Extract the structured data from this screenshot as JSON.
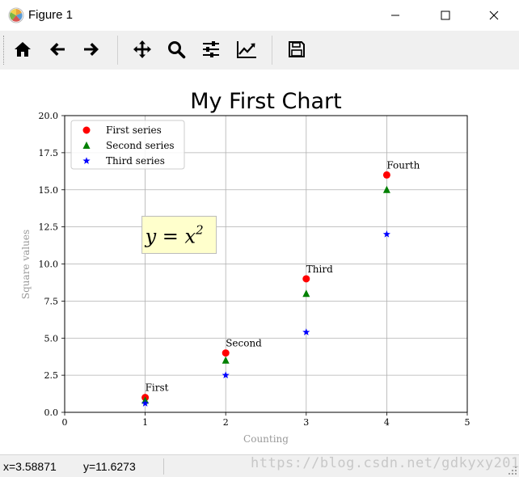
{
  "window": {
    "title": "Figure 1",
    "icon": "matplotlib-logo-icon",
    "controls": [
      "minimize-icon",
      "maximize-icon",
      "close-icon"
    ]
  },
  "toolbar": {
    "buttons": [
      {
        "name": "home-button",
        "icon": "home-icon"
      },
      {
        "name": "back-button",
        "icon": "arrow-left-icon"
      },
      {
        "name": "forward-button",
        "icon": "arrow-right-icon"
      },
      {
        "name": "pan-button",
        "icon": "move-icon"
      },
      {
        "name": "zoom-button",
        "icon": "magnifier-icon"
      },
      {
        "name": "subplots-button",
        "icon": "sliders-icon"
      },
      {
        "name": "customize-button",
        "icon": "line-chart-icon"
      },
      {
        "name": "save-button",
        "icon": "floppy-disk-icon"
      }
    ]
  },
  "status": {
    "x_readout": "x=3.58871",
    "y_readout": "y=11.6273",
    "watermark": "https://blog.csdn.net/gdkyxy2013"
  },
  "colors": {
    "first": "#ff0000",
    "second": "#008000",
    "third": "#0000ff",
    "annotation_box": "#ffffcc",
    "grid": "#b0b0b0"
  },
  "chart_data": {
    "type": "scatter",
    "title": "My First Chart",
    "xlabel": "Counting",
    "ylabel": "Square values",
    "xlim": [
      0,
      5
    ],
    "ylim": [
      0,
      20
    ],
    "xticks": [
      "0",
      "1",
      "2",
      "3",
      "4",
      "5"
    ],
    "yticks": [
      "0.0",
      "2.5",
      "5.0",
      "7.5",
      "10.0",
      "12.5",
      "15.0",
      "17.5",
      "20.0"
    ],
    "grid": true,
    "legend_location": "upper-left",
    "series": [
      {
        "name": "First series",
        "marker": "circle",
        "x": [
          1,
          2,
          3,
          4
        ],
        "y": [
          1,
          4,
          9,
          16
        ]
      },
      {
        "name": "Second series",
        "marker": "triangle",
        "x": [
          1,
          2,
          3,
          4
        ],
        "y": [
          0.8,
          3.5,
          8,
          15
        ]
      },
      {
        "name": "Third series",
        "marker": "star",
        "x": [
          1,
          2,
          3,
          4
        ],
        "y": [
          0.6,
          2.5,
          5.4,
          12
        ]
      }
    ],
    "annotations": [
      {
        "text": "First",
        "x": 1,
        "y": 1
      },
      {
        "text": "Second",
        "x": 2,
        "y": 4
      },
      {
        "text": "Third",
        "x": 3,
        "y": 9
      },
      {
        "text": "Fourth",
        "x": 4,
        "y": 16
      }
    ],
    "formula": {
      "base": "y = x",
      "exponent": "2",
      "x": 1,
      "y": 11.8
    }
  }
}
